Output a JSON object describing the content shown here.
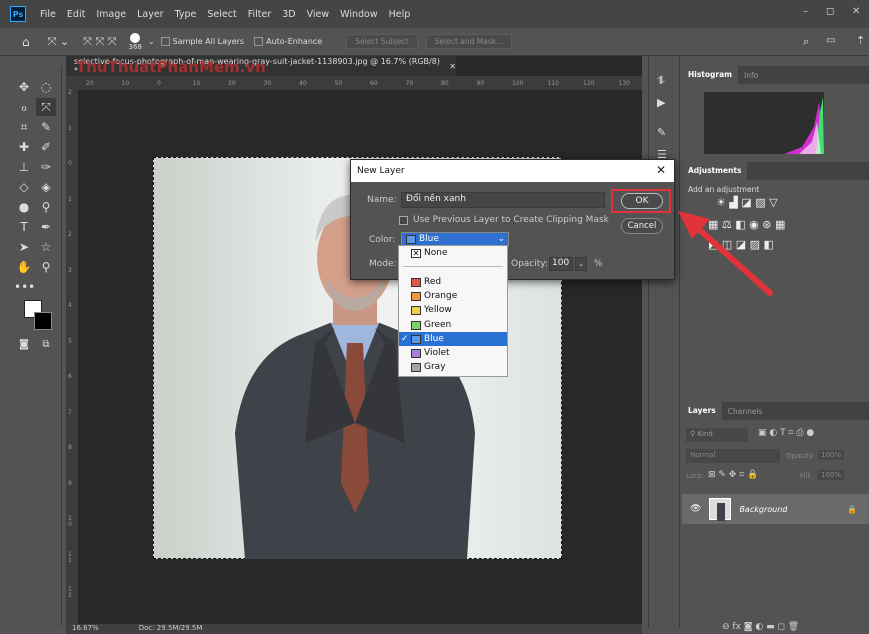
{
  "menubar": {
    "logo": "Ps",
    "items": [
      "File",
      "Edit",
      "Image",
      "Layer",
      "Type",
      "Select",
      "Filter",
      "3D",
      "View",
      "Window",
      "Help"
    ],
    "window_controls": [
      "–",
      "◻",
      "✕"
    ]
  },
  "options_bar": {
    "brush_size": "368",
    "sample_all_layers": "Sample All Layers",
    "auto_enhance": "Auto-Enhance",
    "select_subject": "Select Subject",
    "select_and_mask": "Select and Mask..."
  },
  "document": {
    "tab_title": "selective-focus-photograph-of-man-wearing-gray-suit-jacket-1138903.jpg @ 16.7% (RGB/8) *",
    "watermark": "ThuThuatPhanMem.vn",
    "ruler_top": [
      "20",
      "10",
      "0",
      "10",
      "20",
      "30",
      "40",
      "50",
      "60",
      "70",
      "80",
      "90",
      "100",
      "110",
      "120",
      "130"
    ],
    "ruler_left": [
      "2",
      "1",
      "0",
      "1",
      "2",
      "3",
      "4",
      "5",
      "6",
      "7",
      "8",
      "9",
      "1 0",
      "1 1",
      "1 2"
    ],
    "zoom": "16.67%",
    "doc_size": "Doc: 29.5M/29.5M"
  },
  "panels": {
    "histogram_tab": "Histogram",
    "info_tab": "Info",
    "adjustments_tab": "Adjustments",
    "add_adjustment": "Add an adjustment",
    "layers_tab": "Layers",
    "channels_tab": "Channels",
    "kind": "Kind",
    "blend_mode": "Normal",
    "opacity_label": "Opacity:",
    "opacity_value": "100%",
    "lock_label": "Lock:",
    "fill_label": "Fill:",
    "fill_value": "100%",
    "layer_name": "Background"
  },
  "dialog": {
    "title": "New Layer",
    "name_label": "Name:",
    "name_value": "Đổi nền xanh",
    "clip_label": "Use Previous Layer to Create Clipping Mask",
    "color_label": "Color:",
    "color_value": "Blue",
    "mode_label": "Mode:",
    "opacity_label": "Opacity:",
    "opacity_value": "100",
    "percent": "%",
    "ok": "OK",
    "cancel": "Cancel",
    "options": [
      {
        "label": "None",
        "color": ""
      },
      {
        "label": "Red",
        "color": "#e8534a"
      },
      {
        "label": "Orange",
        "color": "#f0953a"
      },
      {
        "label": "Yellow",
        "color": "#e8d24a"
      },
      {
        "label": "Green",
        "color": "#7ccf6a"
      },
      {
        "label": "Blue",
        "color": "#5b9be6"
      },
      {
        "label": "Violet",
        "color": "#a97fdc"
      },
      {
        "label": "Gray",
        "color": "#a5a5a5"
      }
    ],
    "selected_index": 5
  },
  "colors": {
    "highlight": "#e0333a",
    "selection_blue": "#2a71d4"
  }
}
